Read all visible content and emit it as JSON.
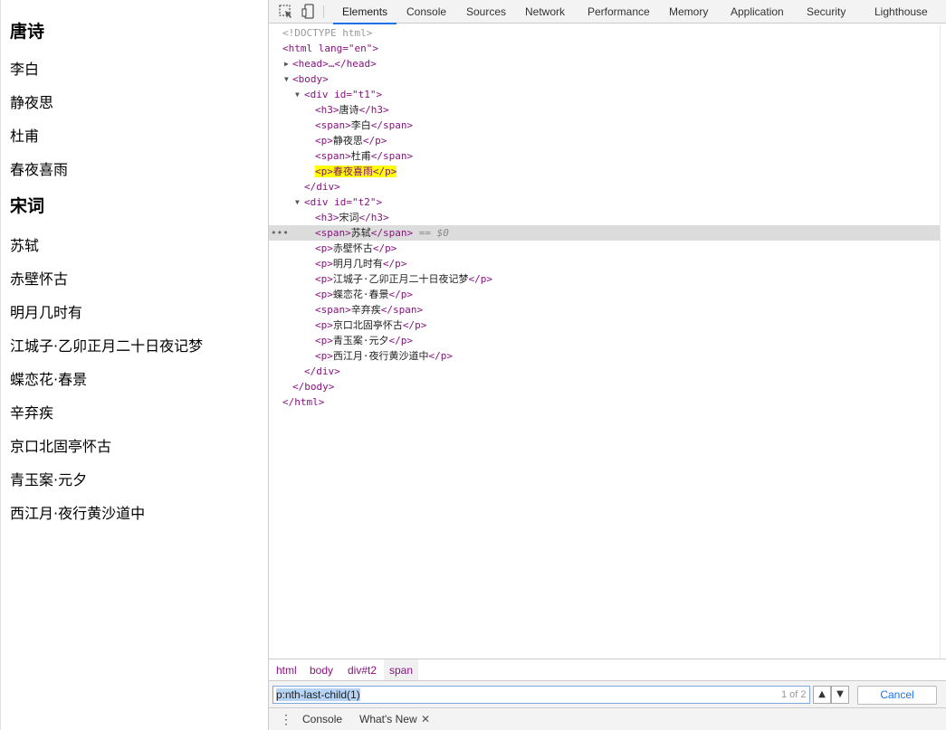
{
  "page": {
    "h1": "唐诗",
    "t1_items": [
      "李白",
      "静夜思",
      "杜甫",
      "春夜喜雨"
    ],
    "h2": "宋词",
    "t2_items": [
      "苏轼",
      "赤壁怀古",
      "明月几时有",
      "江城子·乙卯正月二十日夜记梦",
      "蝶恋花·春景",
      "辛弃疾",
      "京口北固亭怀古",
      "青玉案·元夕",
      "西江月·夜行黄沙道中"
    ]
  },
  "devtools": {
    "tabs": [
      "Elements",
      "Console",
      "Sources",
      "Network",
      "Performance",
      "Memory",
      "Application",
      "Security",
      "Lighthouse"
    ],
    "active_tab": "Elements",
    "dom": {
      "doctype": "<!DOCTYPE html>",
      "html_open": "<html lang=\"en\">",
      "head": "<head>…</head>",
      "body_open": "<body>",
      "div1_open": "<div id=\"t1\">",
      "div2_open": "<div id=\"t2\">",
      "div_close": "</div>",
      "body_close": "</body>",
      "html_close": "</html>",
      "selected_suffix": "== $0"
    },
    "breadcrumbs": [
      "html",
      "body",
      "div#t2",
      "span"
    ],
    "search": {
      "value": "p:nth-last-child(1)",
      "count": "1 of 2",
      "cancel_label": "Cancel"
    },
    "drawer_tabs": [
      "Console",
      "What's New"
    ]
  },
  "colors": {
    "tag": "#881280",
    "attr_name": "#994500",
    "attr_value": "#1a1aa6",
    "highlight": "#ffff00",
    "selection": "#dcdcdc"
  }
}
